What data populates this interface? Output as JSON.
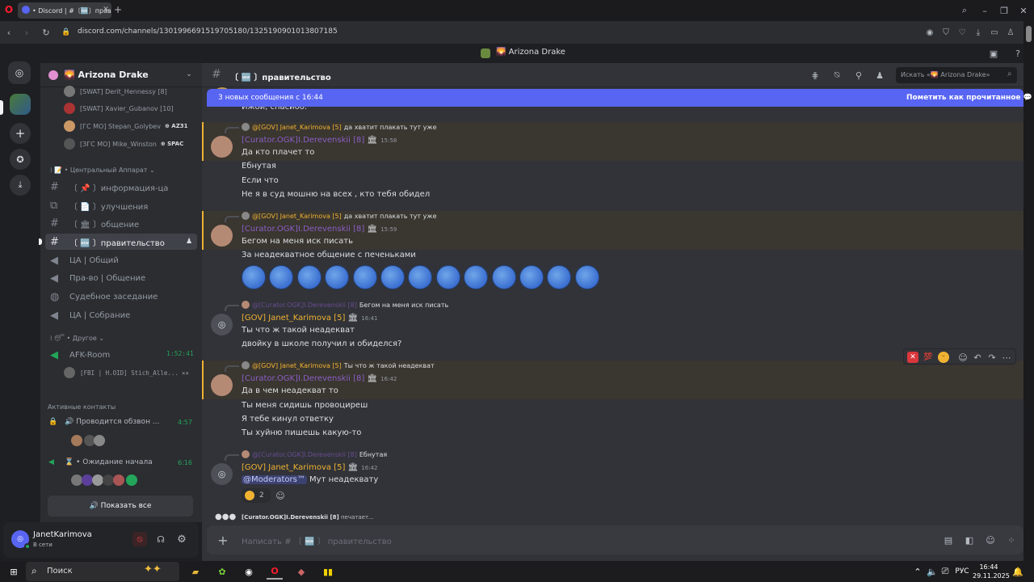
{
  "browser": {
    "tab_title": "• Discord | #〔🆕〕правите",
    "url": "discord.com/channels/1301996691519705180/1325190901013807185"
  },
  "window_title": "Arizona Drake",
  "server": {
    "name": "Arizona Drake"
  },
  "top_members": [
    {
      "name": "[SWAT] Derit_Hennessy [8]",
      "tag": ""
    },
    {
      "name": "[SWAT] Xavier_Gubanov [10]",
      "tag": ""
    },
    {
      "name": "[ГС МО] Stepan_Golybev",
      "tag": "AZ31"
    },
    {
      "name": "[ЗГС МО] Mike_Winston",
      "tag": "SPAC"
    }
  ],
  "category_central": "Центральный Аппарат",
  "channels": [
    {
      "label": "〔 📌 〕информация-ца"
    },
    {
      "label": "〔 📄 〕улучшения"
    },
    {
      "label": "〔 🏛 〕общение"
    },
    {
      "label": "〔 🆕 〕правительство"
    },
    {
      "label": "ЦА | Общий"
    },
    {
      "label": "Пра-во | Общение"
    },
    {
      "label": "Судебное заседание"
    },
    {
      "label": "ЦА | Собрание"
    }
  ],
  "category_other": "Другое",
  "afk": {
    "label": "AFK-Room",
    "timer": "1:52:41",
    "member": "[FBI | H.OID] Stich_Alle..."
  },
  "active_contacts": {
    "title": "Активные контакты",
    "items": [
      {
        "label": "Проводится обзвон ...",
        "time": "4:57"
      },
      {
        "label": "Ожидание начала",
        "time": "6:16"
      }
    ],
    "show_all": "Показать все"
  },
  "user": {
    "name": "JanetKarimova",
    "status": "В сети"
  },
  "header": {
    "channel": "〔 🆕 〕правительство",
    "search_placeholder": "Искать «🌄 Arizona Drake»"
  },
  "banner": {
    "text": "3 новых сообщения с 16:44",
    "action": "Пометить как прочитанное"
  },
  "partial_line": "Ижои, спасибо.",
  "messages": [
    {
      "reply_name": "@[GOV] Janet_Karimova [5]",
      "reply_text": "да хватит плакать тут уже",
      "author": "[Curator.OGK]I.Derevenskii [8]",
      "time": "15:58",
      "lines": [
        "Да кто плачет то",
        "Ебнутая",
        "Если что",
        "Не я в суд мошню на всех , кто тебя обидел"
      ]
    },
    {
      "reply_name": "@[GOV] Janet_Karimova [5]",
      "reply_text": "да хватит плакать тут уже",
      "author": "[Curator.OGK]I.Derevenskii [8]",
      "time": "15:59",
      "lines": [
        "Бегом на меня иск писать",
        "За неадекватное общение с печеньками"
      ]
    },
    {
      "reply_name": "@[Curator.OGK]I.Derevenskii [8]",
      "reply_text": "Бегом на меня иск писать",
      "author": "[GOV] Janet_Karimova [5]",
      "time": "16:41",
      "lines": [
        "Ты что ж такой неадекват",
        "двойку в школе получил и обиделся?"
      ]
    },
    {
      "reply_name": "@[GOV] Janet_Karimova [5]",
      "reply_text": "Ты что ж такой неадекват",
      "author": "[Curator.OGK]I.Derevenskii [8]",
      "time": "16:42",
      "lines": [
        "Да в чем неадекват то",
        "Ты меня сидишь провоциреш",
        "Я тебе кинул ответку",
        "Ты хуйню пишешь какую-то"
      ]
    },
    {
      "reply_name": "@[Curator.OGK]I.Derevenskii [8]",
      "reply_text": "Ебнутая",
      "author": "[GOV] Janet_Karimova [5]",
      "time": "16:42",
      "mention": "@Moderators™",
      "lines": [
        "Мут неадеквату"
      ],
      "reaction_count": "2"
    }
  ],
  "reaction_bar": {
    "hundred": "💯"
  },
  "typing": {
    "name": "[Curator.OGK]I.Derevenskii [8]",
    "text": "печатает..."
  },
  "composer": {
    "placeholder": "Написать # 〔 🆕 〕 правительство"
  },
  "taskbar": {
    "search": "Поиск",
    "lang": "РУС",
    "time": "16:44",
    "date": "29.11.2025"
  },
  "colors": {
    "accent": "#5865f2",
    "gov_gold": "#f0b232",
    "curator_purple": "#8a5fc4",
    "online": "#23a55a"
  }
}
